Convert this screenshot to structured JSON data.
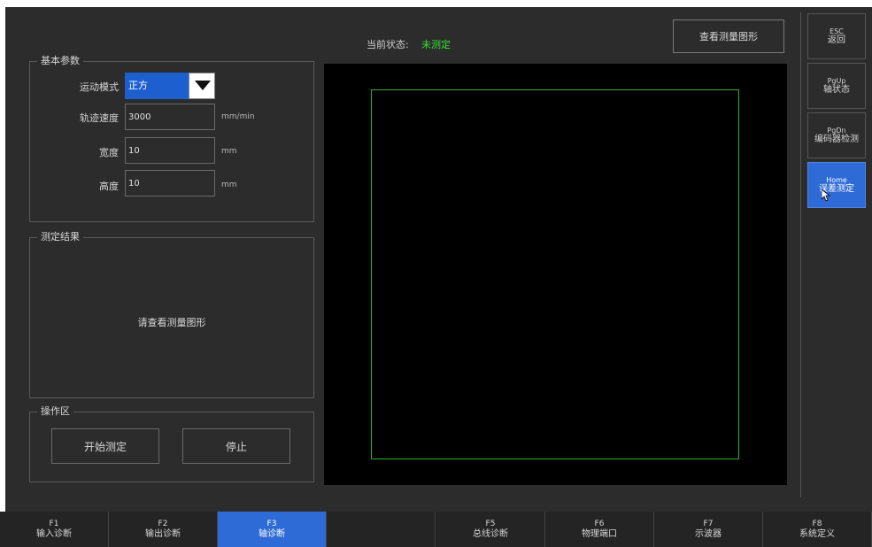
{
  "colors": {
    "background": "#2c2c2c",
    "accent": "#2f6bd6",
    "status_ok": "#36e036",
    "graph_bg": "#000000",
    "graph_rect": "#30b030"
  },
  "status": {
    "label": "当前状态:",
    "value": "未测定"
  },
  "view_graph_button": "查看测量图形",
  "basic_params": {
    "title": "基本参数",
    "mode_label": "运动模式",
    "mode_value": "正方",
    "speed_label": "轨迹速度",
    "speed_value": "3000",
    "speed_unit": "mm/min",
    "width_label": "宽度",
    "width_value": "10",
    "width_unit": "mm",
    "height_label": "高度",
    "height_value": "10",
    "height_unit": "mm"
  },
  "result": {
    "title": "测定结果",
    "text": "请查看测量图形"
  },
  "operation": {
    "title": "操作区",
    "start_button": "开始测定",
    "stop_button": "停止"
  },
  "sidebar": [
    {
      "key": "ESC",
      "label": "返回",
      "active": false
    },
    {
      "key": "PgUp",
      "label": "轴状态",
      "active": false
    },
    {
      "key": "PgDn",
      "label": "编码器检测",
      "active": false
    },
    {
      "key": "Home",
      "label": "误差测定",
      "active": true
    }
  ],
  "fkeys": [
    {
      "key": "F1",
      "label": "输入诊断",
      "active": false
    },
    {
      "key": "F2",
      "label": "输出诊断",
      "active": false
    },
    {
      "key": "F3",
      "label": "轴诊断",
      "active": true
    },
    {
      "key": "",
      "label": "",
      "active": false
    },
    {
      "key": "F5",
      "label": "总线诊断",
      "active": false
    },
    {
      "key": "F6",
      "label": "物理端口",
      "active": false
    },
    {
      "key": "F7",
      "label": "示波器",
      "active": false
    },
    {
      "key": "F8",
      "label": "系统定义",
      "active": false
    }
  ]
}
